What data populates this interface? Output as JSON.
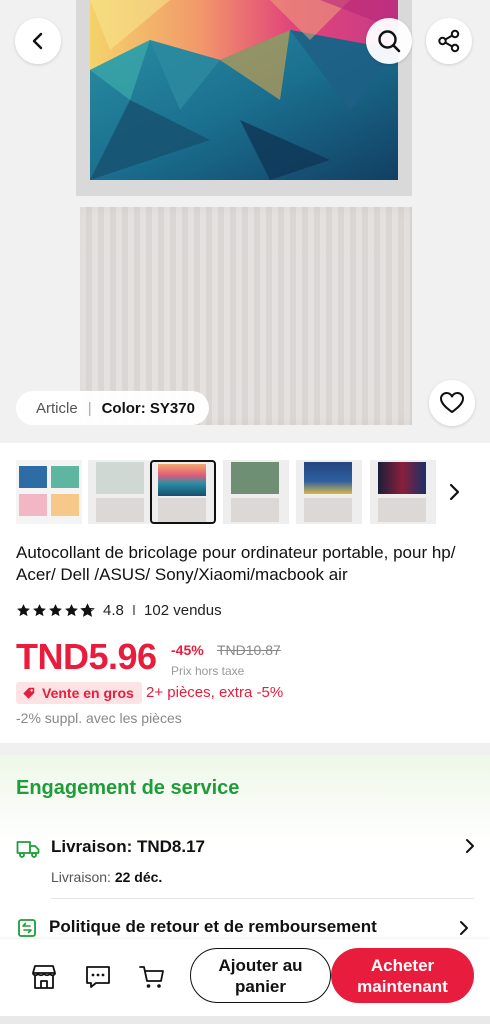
{
  "hero": {
    "variant_label": "Article",
    "variant_value": "Color: SY370",
    "icons": [
      "back-icon",
      "search-icon",
      "share-icon",
      "heart-icon"
    ]
  },
  "thumbnails": {
    "count": 6,
    "selected_index": 2,
    "next_icon": "chevron-right-icon"
  },
  "product": {
    "title": "Autocollant de bricolage pour ordinateur portable, pour hp/ Acer/ Dell /ASUS/ Sony/Xiaomi/macbook air",
    "rating": "4.8",
    "rating_stars": 4.8,
    "sold": "102 vendus"
  },
  "pricing": {
    "price": "TND5.96",
    "discount": "-45%",
    "original_price": "TND10.87",
    "tax_note": "Prix hors taxe",
    "bulk_badge": "Vente en gros",
    "bulk_offer": "2+ pièces, extra -5%",
    "bulk_note": "-2% suppl. avec les pièces"
  },
  "service": {
    "title": "Engagement de service",
    "shipping_title": "Livraison: TND8.17",
    "shipping_sub_label": "Livraison:",
    "shipping_sub_value": "22 déc.",
    "return_title": "Politique de retour et de remboursement"
  },
  "bottom_bar": {
    "add_to_cart": "Ajouter au panier",
    "buy_now": "Acheter maintenant",
    "icons": [
      "store-icon",
      "message-icon",
      "cart-icon"
    ]
  },
  "colors": {
    "accent_red": "#e81c3c",
    "service_green": "#1f9d3a"
  }
}
